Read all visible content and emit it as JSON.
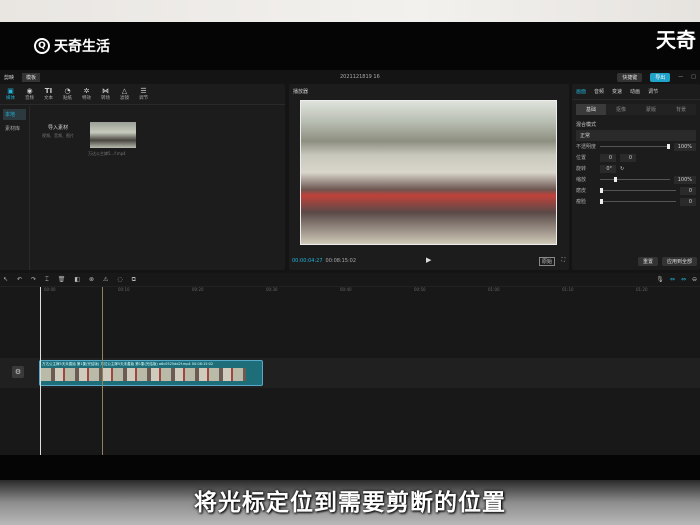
{
  "watermark": {
    "logo_text": "天奇生活",
    "corner_text": "天奇"
  },
  "titlebar": {
    "app": "剪映",
    "mode": "模板",
    "project": "2021121819 16",
    "shortcut_btn": "快捷键",
    "export_btn": "导出"
  },
  "media": {
    "tools": [
      {
        "label": "媒体",
        "icon": "media-icon"
      },
      {
        "label": "音频",
        "icon": "audio-icon"
      },
      {
        "label": "文本",
        "icon": "text-icon"
      },
      {
        "label": "贴纸",
        "icon": "sticker-icon"
      },
      {
        "label": "特效",
        "icon": "effects-icon"
      },
      {
        "label": "转场",
        "icon": "transition-icon"
      },
      {
        "label": "滤镜",
        "icon": "filter-icon"
      },
      {
        "label": "调节",
        "icon": "adjust-icon"
      }
    ],
    "side": [
      "本地",
      "素材库"
    ],
    "import_label": "导入素材",
    "import_hint": "视频、音频、图片",
    "clip_name": "万达公主嫁5...f.mp4"
  },
  "player": {
    "title": "播放器",
    "current_time": "00:00:04:27",
    "total_time": "00:08:15:02",
    "ratio_label": "原始"
  },
  "props": {
    "tabs": [
      "画面",
      "音频",
      "变速",
      "动画",
      "调节"
    ],
    "subtabs": [
      "基础",
      "抠像",
      "蒙版",
      "背景"
    ],
    "blend_label": "混合模式",
    "blend_value": "正常",
    "opacity_label": "不透明度",
    "opacity_value": "100%",
    "opacity_fraction": 1.0,
    "position_label": "位置",
    "pos_x": "0",
    "pos_y": "0",
    "rotate_label": "旋转",
    "rotate_value": "0°",
    "scale_label": "缩放",
    "scale_value": "100%",
    "smooth_label": "磨皮",
    "smooth_value": "0",
    "slim_label": "瘦脸",
    "slim_value": "0",
    "reset_btn": "重置",
    "apply_all_btn": "应用到全部"
  },
  "timeline": {
    "ruler": [
      "00:00",
      "00:10",
      "00:20",
      "00:30",
      "00:40",
      "00:50",
      "01:00",
      "01:10",
      "01:20"
    ],
    "clip_title": "万达公主嫁5天未善始 第1集(完结版)  万达公主嫁5天未善始 第1集(完结版)  a6c0525dd2f.mp4  00:08:15:02"
  },
  "caption": "将光标定位到需要剪断的位置",
  "colors": {
    "accent": "#22b3d8",
    "clip": "#1e6e7a"
  }
}
